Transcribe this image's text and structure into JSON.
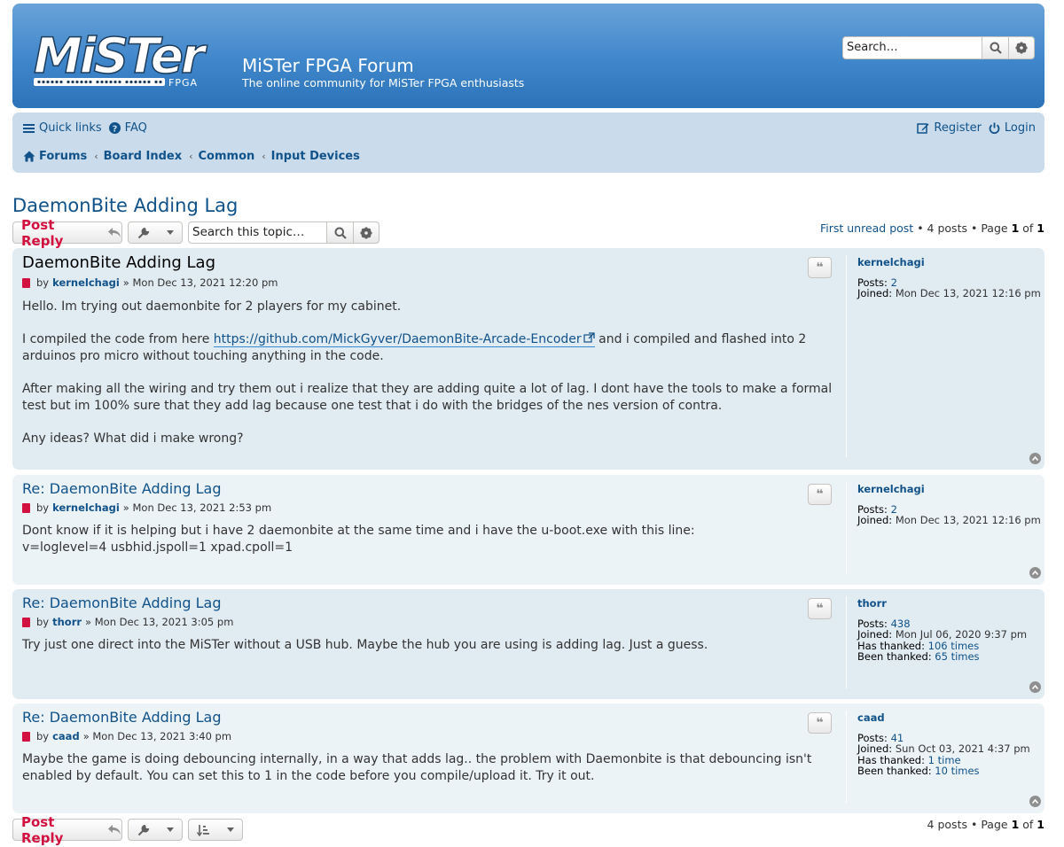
{
  "header": {
    "logo_text": "MiSTer FPGA",
    "site_title": "MiSTer FPGA Forum",
    "site_description": "The online community for MiSTer FPGA enthusiasts",
    "search_placeholder": "Search…"
  },
  "nav": {
    "quick_links": "Quick links",
    "faq": "FAQ",
    "register": "Register",
    "login": "Login",
    "breadcrumbs": [
      "Forums",
      "Board Index",
      "Common",
      "Input Devices"
    ]
  },
  "topic": {
    "title": "DaemonBite Adding Lag",
    "post_reply": "Post Reply",
    "search_placeholder": "Search this topic…",
    "first_unread": "First unread post",
    "posts_count": "4 posts",
    "page_label": "Page",
    "page_current": "1",
    "page_of": "of",
    "page_total": "1"
  },
  "posts": [
    {
      "title": "DaemonBite Adding Lag",
      "by": "by",
      "author": "kernelchagi",
      "date": "» Mon Dec 13, 2021 12:20 pm",
      "paragraphs": [
        "Hello. Im trying out daemonbite for 2 players for my cabinet.",
        "After making all the wiring and try them out i realize that they are adding quite a lot of lag. I dont have the tools to make a formal test but im 100% sure that they add lag because one test that i do with the bridges of the nes version of contra.",
        "Any ideas? What did i make wrong?"
      ],
      "link_before": "I compiled the code from here",
      "link_url": "https://github.com/MickGyver/DaemonBite-Arcade-Encoder",
      "link_after": "and i compiled and flashed into 2 arduinos pro micro without touching anything in the code.",
      "profile": {
        "name": "kernelchagi",
        "posts_label": "Posts:",
        "posts": "2",
        "joined_label": "Joined:",
        "joined": "Mon Dec 13, 2021 12:16 pm"
      }
    },
    {
      "title": "Re: DaemonBite Adding Lag",
      "by": "by",
      "author": "kernelchagi",
      "date": "» Mon Dec 13, 2021 2:53 pm",
      "line1": "Dont know if it is helping but i have 2 daemonbite at the same time and i have the u-boot.exe with this line:",
      "line2": "v=loglevel=4 usbhid.jspoll=1 xpad.cpoll=1",
      "profile": {
        "name": "kernelchagi",
        "posts_label": "Posts:",
        "posts": "2",
        "joined_label": "Joined:",
        "joined": "Mon Dec 13, 2021 12:16 pm"
      }
    },
    {
      "title": "Re: DaemonBite Adding Lag",
      "by": "by",
      "author": "thorr",
      "date": "» Mon Dec 13, 2021 3:05 pm",
      "text": "Try just one direct into the MiSTer without a USB hub. Maybe the hub you are using is adding lag. Just a guess.",
      "profile": {
        "name": "thorr",
        "posts_label": "Posts:",
        "posts": "438",
        "joined_label": "Joined:",
        "joined": "Mon Jul 06, 2020 9:37 pm",
        "thanked_label": "Has thanked:",
        "thanked": "106 times",
        "been_label": "Been thanked:",
        "been": "65 times"
      }
    },
    {
      "title": "Re: DaemonBite Adding Lag",
      "by": "by",
      "author": "caad",
      "date": "» Mon Dec 13, 2021 3:40 pm",
      "text": "Maybe the game is doing debouncing internally, in a way that adds lag.. the problem with Daemonbite is that debouncing isn't enabled by default. You can set this to 1 in the code before you compile/upload it. Try it out.",
      "profile": {
        "name": "caad",
        "posts_label": "Posts:",
        "posts": "41",
        "joined_label": "Joined:",
        "joined": "Sun Oct 03, 2021 4:37 pm",
        "thanked_label": "Has thanked:",
        "thanked": "1 time",
        "been_label": "Been thanked:",
        "been": "10 times"
      }
    }
  ]
}
